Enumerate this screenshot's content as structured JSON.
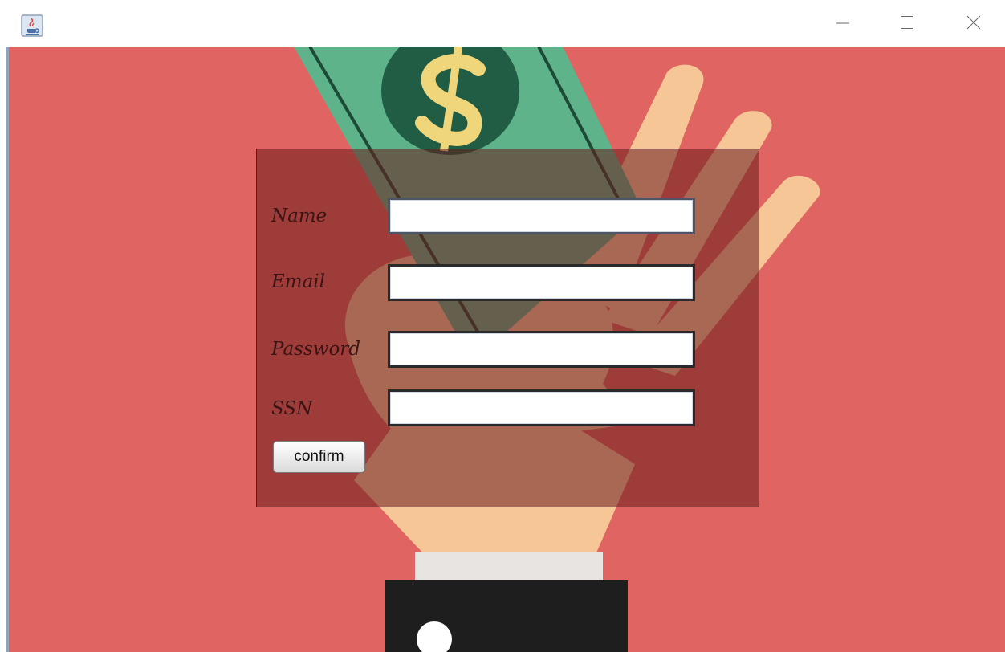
{
  "window": {
    "app_icon": "java-cup-icon",
    "controls": {
      "minimize_icon": "minimize-icon",
      "maximize_icon": "maximize-icon",
      "close_icon": "close-icon"
    }
  },
  "background": {
    "description_icons": [
      "dollar-bill-icon",
      "hand-illustration"
    ],
    "colors": {
      "background": "#e06461",
      "bill": "#5fb38a",
      "coin": "#215c45",
      "dollar_sign": "#f0d67a",
      "hand": "#f7c697",
      "cuff": "#e8e4e1",
      "sleeve": "#1e1e1e"
    }
  },
  "form": {
    "name_label": "Name",
    "email_label": "Email",
    "password_label": "Password",
    "ssn_label": "SSN",
    "name_value": "",
    "email_value": "",
    "password_value": "",
    "ssn_value": "",
    "confirm_label": "confirm"
  }
}
